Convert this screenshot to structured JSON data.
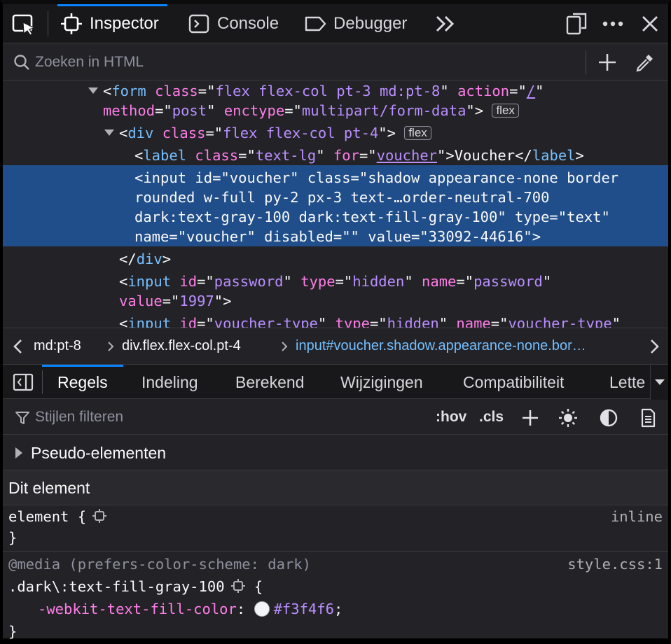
{
  "toolbar": {
    "tabs": [
      {
        "label": "Inspector",
        "icon": "inspector-icon",
        "selected": true
      },
      {
        "label": "Console",
        "icon": "console-icon",
        "selected": false
      },
      {
        "label": "Debugger",
        "icon": "debugger-icon",
        "selected": false
      }
    ],
    "icons": [
      "element-picker-icon",
      "more-tools-icon",
      "responsive-design-icon",
      "more-options-icon",
      "close-icon"
    ]
  },
  "search": {
    "placeholder": "Zoeken in HTML",
    "value": ""
  },
  "markup": {
    "form": {
      "tag": "form",
      "class_attr": "class",
      "class_val": "flex flex-col pt-3 md:pt-8",
      "action_attr": "action",
      "action_val": "/",
      "method_attr": "method",
      "method_val": "post",
      "enctype_attr": "enctype",
      "enctype_val": "multipart/form-data",
      "badge": "flex"
    },
    "div": {
      "tag": "div",
      "class_attr": "class",
      "class_val": "flex flex-col pt-4",
      "badge": "flex"
    },
    "label": {
      "tag": "label",
      "class_attr": "class",
      "class_val": "text-lg",
      "for_attr": "for",
      "for_val": "voucher",
      "text": "Voucher"
    },
    "selected_input": {
      "line1": "<input id=\"voucher\" class=\"shadow appearance-none border",
      "line2": "rounded w-full py-2 px-3 text-…order-neutral-700",
      "line3": "dark:text-gray-100 dark:text-fill-gray-100\" type=\"text\"",
      "line4": "name=\"voucher\" disabled=\"\" value=\"33092-44616\">"
    },
    "div_close": "div",
    "password_input": {
      "tag": "input",
      "id_attr": "id",
      "id_val": "password",
      "type_attr": "type",
      "type_val": "hidden",
      "name_attr": "name",
      "name_val": "password",
      "value_attr": "value",
      "value_val": "1997"
    },
    "type_input": {
      "tag": "input",
      "id_attr": "id",
      "id_val": "voucher-type",
      "type_attr": "type",
      "type_val": "hidden",
      "name_attr": "name",
      "name_val": "voucher-type"
    }
  },
  "breadcrumbs": {
    "items": [
      "md:pt-8",
      "div.flex.flex-col.pt-4",
      "input#voucher.shadow.appearance-none.bor…"
    ]
  },
  "panel": {
    "tabs": [
      {
        "label": "Regels",
        "selected": true
      },
      {
        "label": "Indeling",
        "selected": false
      },
      {
        "label": "Berekend",
        "selected": false
      },
      {
        "label": "Wijzigingen",
        "selected": false
      },
      {
        "label": "Compatibiliteit",
        "selected": false
      },
      {
        "label": "Lette",
        "selected": false
      }
    ]
  },
  "filter": {
    "placeholder": "Stijlen filteren",
    "hov": ":hov",
    "cls": ".cls"
  },
  "rules": {
    "pseudo_label": "Pseudo-elementen",
    "section_title": "Dit element",
    "element_rule": {
      "selector": "element {",
      "source": "inline",
      "close": "}"
    },
    "media_rule": {
      "media": "@media (prefers-color-scheme: dark)",
      "source": "style.css:1",
      "selector": ".dark\\:text-fill-gray-100",
      "open": "{",
      "property": "-webkit-text-fill-color",
      "value": "#f3f4f6",
      "close": "}"
    }
  },
  "colors": {
    "accent": "#0a84ff",
    "selection": "#204e8a",
    "tag": "#75bfff",
    "attr": "#ff7de9",
    "value": "#b98eff",
    "swatch": "#f3f4f6"
  }
}
